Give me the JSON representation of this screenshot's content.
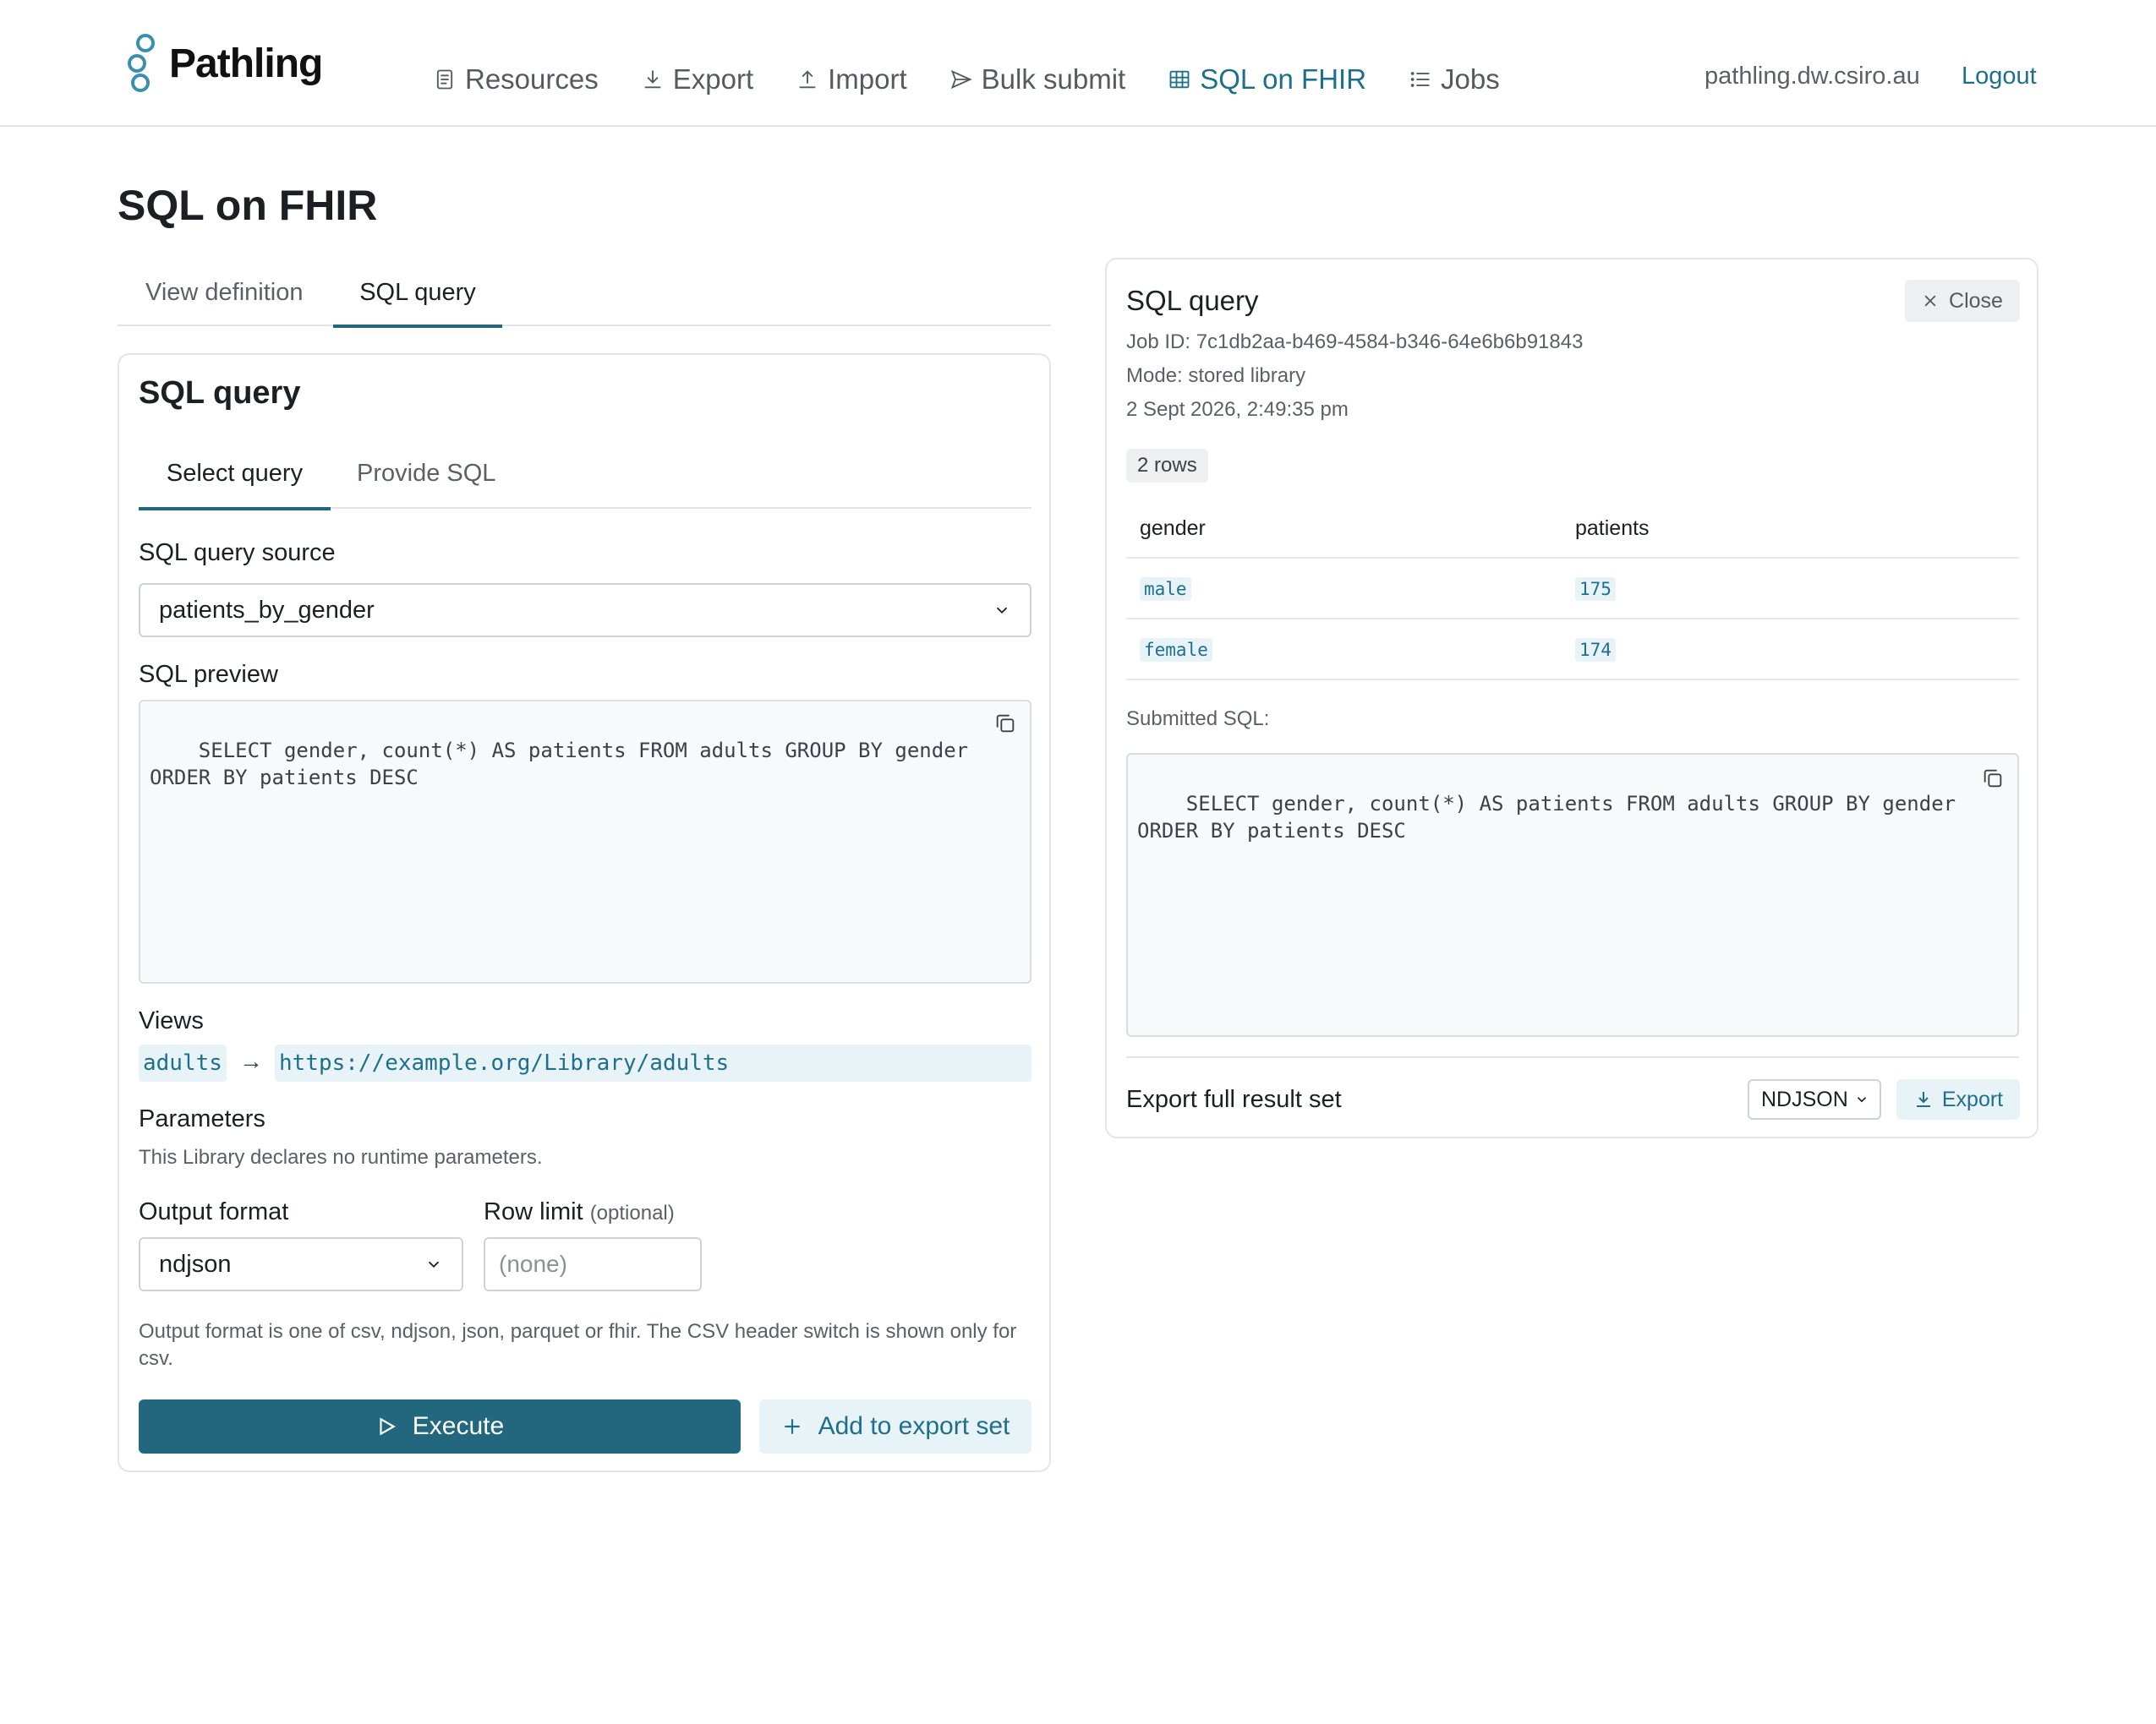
{
  "app": {
    "name": "Pathling",
    "host": "pathling.dw.csiro.au",
    "logout_label": "Logout"
  },
  "nav": {
    "items": [
      {
        "label": "Resources",
        "icon": "document-icon"
      },
      {
        "label": "Export",
        "icon": "download-icon"
      },
      {
        "label": "Import",
        "icon": "upload-icon"
      },
      {
        "label": "Bulk submit",
        "icon": "send-icon"
      },
      {
        "label": "SQL on FHIR",
        "icon": "table-icon",
        "active": true
      },
      {
        "label": "Jobs",
        "icon": "list-icon"
      }
    ]
  },
  "page": {
    "title": "SQL on FHIR"
  },
  "main_tabs": [
    {
      "label": "View definition"
    },
    {
      "label": "SQL query",
      "active": true
    }
  ],
  "query_card": {
    "title": "SQL query",
    "sub_tabs": [
      {
        "label": "Select query",
        "active": true
      },
      {
        "label": "Provide SQL"
      }
    ],
    "source_label": "SQL query source",
    "source_value": "patients_by_gender",
    "preview_label": "SQL preview",
    "preview_sql": "SELECT gender, count(*) AS patients FROM adults GROUP BY gender ORDER BY patients DESC",
    "views_label": "Views",
    "view_name": "adults",
    "view_arrow": "→",
    "view_url": "https://example.org/Library/adults",
    "parameters_label": "Parameters",
    "parameters_note": "This Library declares no runtime parameters.",
    "output_format_label": "Output format",
    "output_format_value": "ndjson",
    "row_limit_label": "Row limit",
    "row_limit_optional": "(optional)",
    "row_limit_placeholder": "(none)",
    "help_text": "Output format is one of csv, ndjson, json, parquet or fhir. The CSV header switch is shown only for csv.",
    "execute_label": "Execute",
    "add_export_label": "Add to export set"
  },
  "result_card": {
    "title": "SQL query",
    "close_label": "Close",
    "job_id": "Job ID: 7c1db2aa-b469-4584-b346-64e6b6b91843",
    "mode": "Mode: stored library",
    "timestamp": "2 Sept 2026, 2:49:35 pm",
    "rows_badge": "2 rows",
    "columns": [
      "gender",
      "patients"
    ],
    "rows": [
      [
        "male",
        "175"
      ],
      [
        "female",
        "174"
      ]
    ],
    "submitted_label": "Submitted SQL:",
    "submitted_sql": "SELECT gender, count(*) AS patients FROM adults GROUP BY gender ORDER BY patients DESC",
    "export_label": "Export full result set",
    "export_format": "NDJSON",
    "export_button": "Export"
  },
  "colors": {
    "accent": "#22677d",
    "link": "#1e6f8c",
    "chip_bg": "#e8f3f8"
  }
}
